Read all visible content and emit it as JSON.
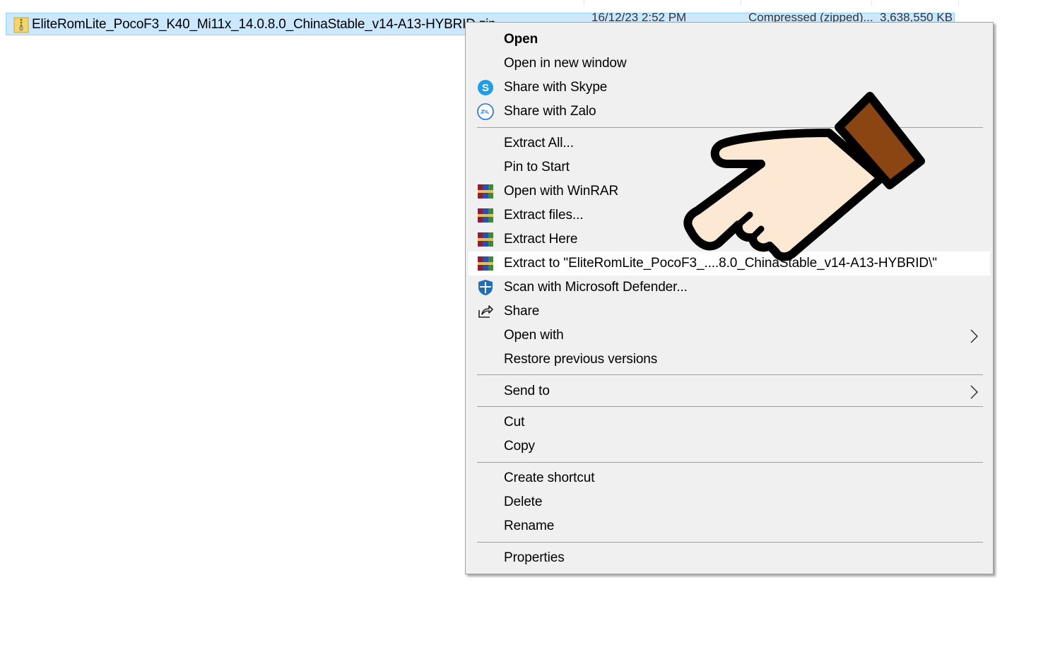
{
  "file": {
    "name": "EliteRomLite_PocoF3_K40_Mi11x_14.0.8.0_ChinaStable_v14-A13-HYBRID.zip",
    "date": "16/12/23 2:52 PM",
    "type": "Compressed (zipped)...",
    "size": "3,638,550 KB",
    "icon": "zip-folder-icon"
  },
  "menu": {
    "open": "Open",
    "open_new_window": "Open in new window",
    "share_skype": "Share with Skype",
    "share_zalo": "Share with Zalo",
    "extract_all": "Extract All...",
    "pin_start": "Pin to Start",
    "open_winrar": "Open with WinRAR",
    "extract_files": "Extract files...",
    "extract_here": "Extract Here",
    "extract_to": "Extract to \"EliteRomLite_PocoF3_....8.0_ChinaStable_v14-A13-HYBRID\\\"",
    "scan_defender": "Scan with Microsoft Defender...",
    "share": "Share",
    "open_with": "Open with",
    "restore_versions": "Restore previous versions",
    "send_to": "Send to",
    "cut": "Cut",
    "copy": "Copy",
    "create_shortcut": "Create shortcut",
    "delete": "Delete",
    "rename": "Rename",
    "properties": "Properties"
  },
  "icons": {
    "skype": "skype-icon",
    "zalo": "zalo-icon",
    "winrar": "winrar-icon",
    "defender": "defender-shield-icon",
    "share": "share-icon",
    "submenu": "chevron-right-icon",
    "pointer": "pointing-hand-icon"
  },
  "colors": {
    "selection": "#cce8ff",
    "menu_bg": "#f0f0f0",
    "highlight": "#ffffff",
    "skype": "#1e9ee6",
    "defender": "#1f6fb8"
  }
}
